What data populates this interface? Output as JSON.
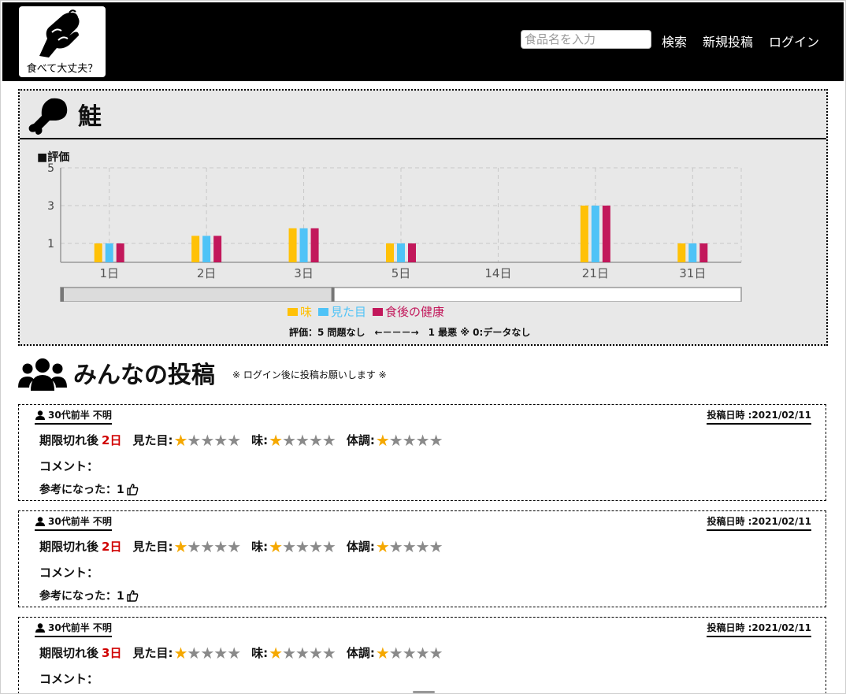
{
  "header": {
    "logo_text": "食べて大丈夫？",
    "search_placeholder": "食品名を入力",
    "nav": {
      "search": "検索",
      "new_post": "新規投稿",
      "login": "ログイン"
    }
  },
  "food": {
    "name": "鮭",
    "rating_label": "■評価",
    "legend": {
      "taste": "味",
      "appearance": "見た目",
      "health": "食後の健康"
    },
    "note": "評価：5 問題なし　←－－－→　1 最悪 ※ 0:データなし"
  },
  "colors": {
    "taste": "#ffc107",
    "appearance": "#4fc3f7",
    "health": "#c2185b",
    "days_red": "#d00000",
    "star_on": "#f5a800",
    "star_off": "#8a8a8a"
  },
  "chart_data": {
    "type": "bar",
    "categories": [
      "1日",
      "2日",
      "3日",
      "5日",
      "14日",
      "21日",
      "31日"
    ],
    "series": [
      {
        "name": "味",
        "values": [
          1,
          1.4,
          1.8,
          1,
          0,
          3,
          1
        ]
      },
      {
        "name": "見た目",
        "values": [
          1,
          1.4,
          1.8,
          1,
          0,
          3,
          1
        ]
      },
      {
        "name": "食後の健康",
        "values": [
          1,
          1.4,
          1.8,
          1,
          0,
          3,
          1
        ]
      }
    ],
    "y_ticks": [
      1,
      3,
      5
    ],
    "ylim": [
      0,
      5
    ],
    "grid": true,
    "legend_position": "bottom",
    "zoom_slider_range": [
      0,
      0.4
    ]
  },
  "posts_section": {
    "title": "みんなの投稿",
    "note": "※ ログイン後に投稿お願いします ※"
  },
  "posts": [
    {
      "user": "30代前半 不明",
      "date": "投稿日時 :2021/02/11",
      "expiry_label": "期限切れ後",
      "days": "2日",
      "appearance_label": "見た目:",
      "appearance_stars": 1,
      "taste_label": "味:",
      "taste_stars": 1,
      "health_label": "体調:",
      "health_stars": 1,
      "comment_label": "コメント：",
      "helpful_label": "参考になった：1"
    },
    {
      "user": "30代前半 不明",
      "date": "投稿日時 :2021/02/11",
      "expiry_label": "期限切れ後",
      "days": "2日",
      "appearance_label": "見た目:",
      "appearance_stars": 1,
      "taste_label": "味:",
      "taste_stars": 1,
      "health_label": "体調:",
      "health_stars": 1,
      "comment_label": "コメント：",
      "helpful_label": "参考になった：1"
    },
    {
      "user": "30代前半 不明",
      "date": "投稿日時 :2021/02/11",
      "expiry_label": "期限切れ後",
      "days": "3日",
      "appearance_label": "見た目:",
      "appearance_stars": 1,
      "taste_label": "味:",
      "taste_stars": 1,
      "health_label": "体調:",
      "health_stars": 1,
      "comment_label": "コメント：",
      "helpful_label": ""
    }
  ]
}
